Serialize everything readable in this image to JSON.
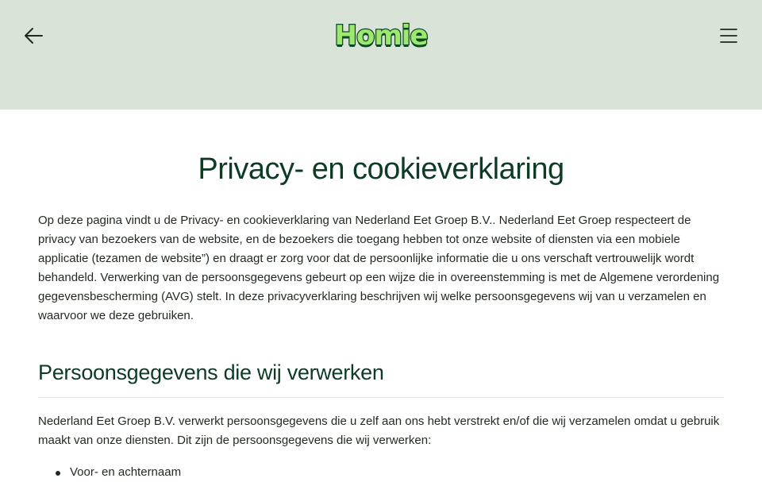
{
  "header": {
    "logo_text": "Homie",
    "icons": {
      "back": "arrow-left-icon",
      "menu": "hamburger-menu-icon"
    }
  },
  "page": {
    "title": "Privacy- en cookieverklaring",
    "intro": "Op deze pagina vindt u de Privacy- en cookieverklaring van Nederland Eet Groep B.V.. Nederland Eet Groep respecteert de privacy van bezoekers van de website, en de bezoekers die toegang hebben tot onze website of diensten via een mobiele applicatie (tezamen de website”) en draagt er zorg voor dat de persoonlijke informatie die u ons verschaft vertrouwelijk wordt behandeld. Verwerking van de persoonsgegevens gebeurt op een wijze die in overeenstemming is met de Algemene verordening gegevensbescherming (AVG) stelt. In deze privacyverklaring beschrijven wij welke persoonsgegevens wij van u verzamelen en waarvoor we deze gebruiken."
  },
  "section": {
    "title": "Persoonsgegevens die wij verwerken",
    "text": "Nederland Eet Groep B.V. verwerkt persoonsgegevens die u zelf aan ons hebt verstrekt en/of die wij verzamelen omdat u gebruik maakt van onze diensten. Dit zijn de persoonsgegevens die wij verwerken:",
    "items": [
      "Voor- en achternaam"
    ]
  },
  "colors": {
    "header_bg": "#d9e3d7",
    "title": "#0d3b24",
    "logo_fill": "#9fe870",
    "logo_outline": "#0b4a24",
    "text": "#1f2a1f"
  }
}
